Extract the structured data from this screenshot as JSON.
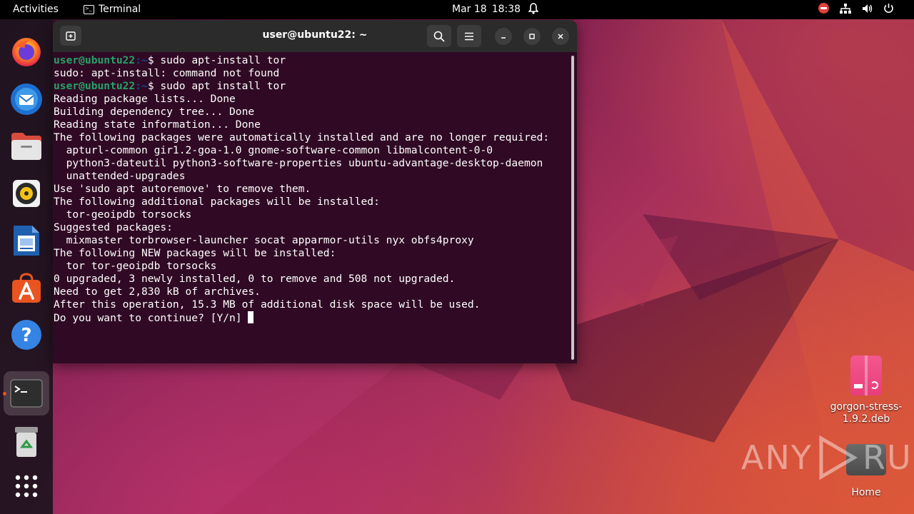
{
  "topbar": {
    "activities": "Activities",
    "app_name": "Terminal",
    "app_icon_glyph": ">_",
    "date": "Mar 18",
    "time": "18:38",
    "icons": [
      "bell-icon",
      "do-not-disturb-icon",
      "network-icon",
      "volume-icon",
      "power-icon"
    ]
  },
  "dock": {
    "items": [
      {
        "name": "firefox",
        "icon": "firefox-icon"
      },
      {
        "name": "thunderbird",
        "icon": "thunderbird-icon"
      },
      {
        "name": "files",
        "icon": "files-icon"
      },
      {
        "name": "rhythmbox",
        "icon": "rhythmbox-icon"
      },
      {
        "name": "libreoffice-writer",
        "icon": "writer-icon"
      },
      {
        "name": "ubuntu-software",
        "icon": "software-icon"
      },
      {
        "name": "help",
        "icon": "help-icon"
      },
      {
        "name": "terminal",
        "icon": "terminal-icon",
        "active": true
      },
      {
        "name": "trash",
        "icon": "trash-icon"
      },
      {
        "name": "show-apps",
        "icon": "app-grid-icon"
      }
    ],
    "accent": "#e95420"
  },
  "terminal": {
    "title": "user@ubuntu22: ~",
    "prompt_user": "user@ubuntu22",
    "prompt_path": ":~",
    "prompt_symbol": "$ ",
    "colors": {
      "background": "#300a24",
      "user": "#26a269",
      "path": "#12488b",
      "text": "#ffffff"
    },
    "lines": [
      {
        "type": "prompt",
        "cmd": "sudo apt-install tor"
      },
      {
        "type": "out",
        "text": "sudo: apt-install: command not found"
      },
      {
        "type": "prompt",
        "cmd": "sudo apt install tor"
      },
      {
        "type": "out",
        "text": "Reading package lists... Done"
      },
      {
        "type": "out",
        "text": "Building dependency tree... Done"
      },
      {
        "type": "out",
        "text": "Reading state information... Done"
      },
      {
        "type": "out",
        "text": "The following packages were automatically installed and are no longer required:"
      },
      {
        "type": "out",
        "text": "  apturl-common gir1.2-goa-1.0 gnome-software-common libmalcontent-0-0"
      },
      {
        "type": "out",
        "text": "  python3-dateutil python3-software-properties ubuntu-advantage-desktop-daemon"
      },
      {
        "type": "out",
        "text": "  unattended-upgrades"
      },
      {
        "type": "out",
        "text": "Use 'sudo apt autoremove' to remove them."
      },
      {
        "type": "out",
        "text": "The following additional packages will be installed:"
      },
      {
        "type": "out",
        "text": "  tor-geoipdb torsocks"
      },
      {
        "type": "out",
        "text": "Suggested packages:"
      },
      {
        "type": "out",
        "text": "  mixmaster torbrowser-launcher socat apparmor-utils nyx obfs4proxy"
      },
      {
        "type": "out",
        "text": "The following NEW packages will be installed:"
      },
      {
        "type": "out",
        "text": "  tor tor-geoipdb torsocks"
      },
      {
        "type": "out",
        "text": "0 upgraded, 3 newly installed, 0 to remove and 508 not upgraded."
      },
      {
        "type": "out",
        "text": "Need to get 2,830 kB of archives."
      },
      {
        "type": "out",
        "text": "After this operation, 15.3 MB of additional disk space will be used."
      },
      {
        "type": "cursor",
        "text": "Do you want to continue? [Y/n] "
      }
    ]
  },
  "desktop": {
    "file_label": "gorgon-stress-1.9.2.deb",
    "home_label": "Home"
  },
  "watermark": {
    "text_left": "ANY",
    "text_right": "RUN"
  }
}
